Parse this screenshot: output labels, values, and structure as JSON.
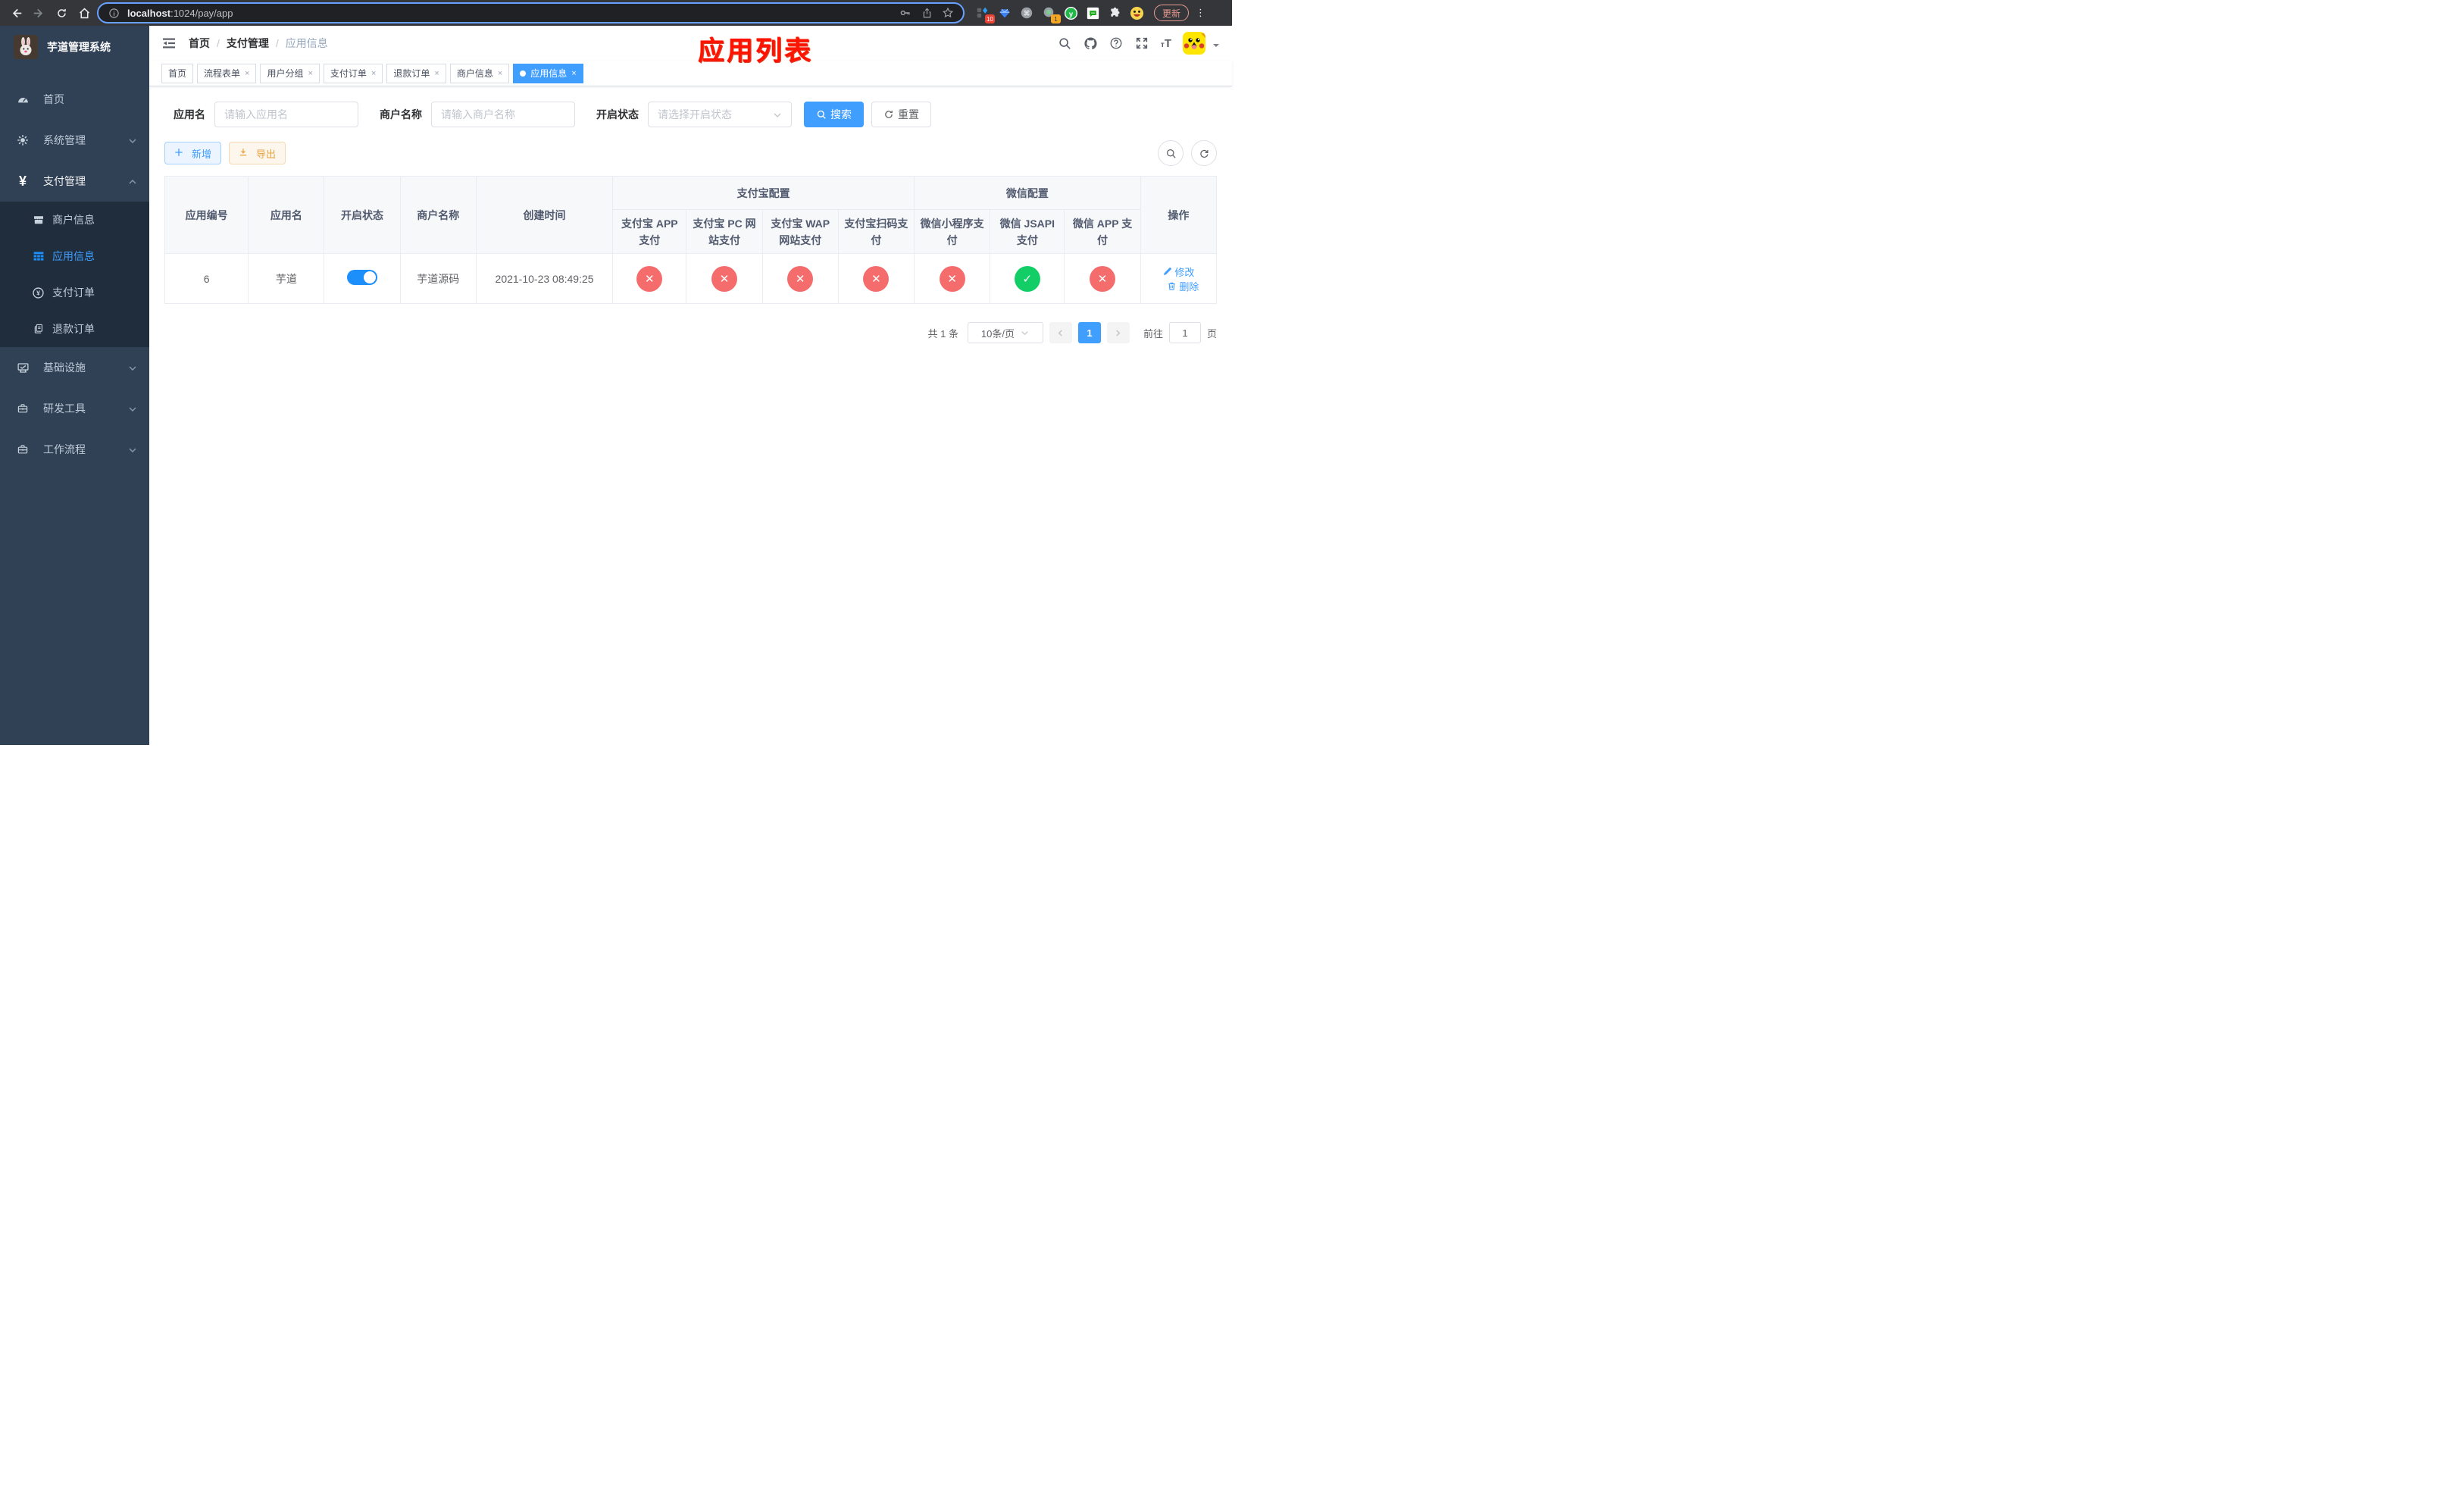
{
  "browser": {
    "url_host": "localhost",
    "url_path": ":1024/pay/app",
    "ext_badge_blue": "10",
    "ext_badge_green": "1",
    "update_label": "更新"
  },
  "sidebar": {
    "title": "芋道管理系统",
    "items": [
      {
        "label": "首页",
        "icon": "dashboard-icon"
      },
      {
        "label": "系统管理",
        "icon": "gear-icon",
        "state": "collapsed"
      },
      {
        "label": "支付管理",
        "icon": "yen-icon",
        "state": "expanded"
      },
      {
        "label": "基础设施",
        "icon": "monitor-icon",
        "state": "collapsed"
      },
      {
        "label": "研发工具",
        "icon": "toolbox-icon",
        "state": "collapsed"
      },
      {
        "label": "工作流程",
        "icon": "briefcase-icon",
        "state": "collapsed"
      }
    ],
    "submenu": [
      {
        "label": "商户信息",
        "icon": "shop-icon",
        "active": false
      },
      {
        "label": "应用信息",
        "icon": "grid-icon",
        "active": true
      },
      {
        "label": "支付订单",
        "icon": "pay-order-icon",
        "active": false
      },
      {
        "label": "退款订单",
        "icon": "refund-icon",
        "active": false
      }
    ]
  },
  "navbar": {
    "breadcrumb": [
      "首页",
      "支付管理",
      "应用信息"
    ],
    "separator": "/",
    "annotation": "应用列表"
  },
  "tabs": [
    {
      "label": "首页",
      "closable": false,
      "active": false
    },
    {
      "label": "流程表单",
      "closable": true,
      "active": false
    },
    {
      "label": "用户分组",
      "closable": true,
      "active": false
    },
    {
      "label": "支付订单",
      "closable": true,
      "active": false
    },
    {
      "label": "退款订单",
      "closable": true,
      "active": false
    },
    {
      "label": "商户信息",
      "closable": true,
      "active": false
    },
    {
      "label": "应用信息",
      "closable": true,
      "active": true
    }
  ],
  "filters": {
    "app_name_label": "应用名",
    "app_name_placeholder": "请输入应用名",
    "merchant_label": "商户名称",
    "merchant_placeholder": "请输入商户名称",
    "status_label": "开启状态",
    "status_placeholder": "请选择开启状态",
    "search_label": "搜索",
    "reset_label": "重置"
  },
  "toolbar": {
    "add_label": "新增",
    "export_label": "导出"
  },
  "table": {
    "group_alipay": "支付宝配置",
    "group_wechat": "微信配置",
    "columns": [
      "应用编号",
      "应用名",
      "开启状态",
      "商户名称",
      "创建时间",
      "支付宝 APP 支付",
      "支付宝 PC 网站支付",
      "支付宝 WAP 网站支付",
      "支付宝扫码支付",
      "微信小程序支付",
      "微信 JSAPI 支付",
      "微信 APP 支付",
      "操作"
    ],
    "row": {
      "id": "6",
      "name": "芋道",
      "enabled": true,
      "merchant": "芋道源码",
      "created_at": "2021-10-23 08:49:25",
      "payment_status": [
        false,
        false,
        false,
        false,
        false,
        true,
        false
      ],
      "edit_label": "修改",
      "delete_label": "删除"
    }
  },
  "pagination": {
    "total": "共 1 条",
    "page_size": "10条/页",
    "page": "1",
    "goto_label": "前往",
    "goto_value": "1",
    "page_unit": "页"
  },
  "icons": {
    "check": "✓",
    "cross": "✕",
    "close": "×"
  },
  "colors": {
    "accent": "#409eff",
    "danger": "#f56c6c",
    "success": "#13ce66",
    "sidebar_bg": "#304156",
    "submenu_bg": "#1f2d3d",
    "annotation_red": "#fe1300",
    "export_orange": "#e6a23c"
  }
}
